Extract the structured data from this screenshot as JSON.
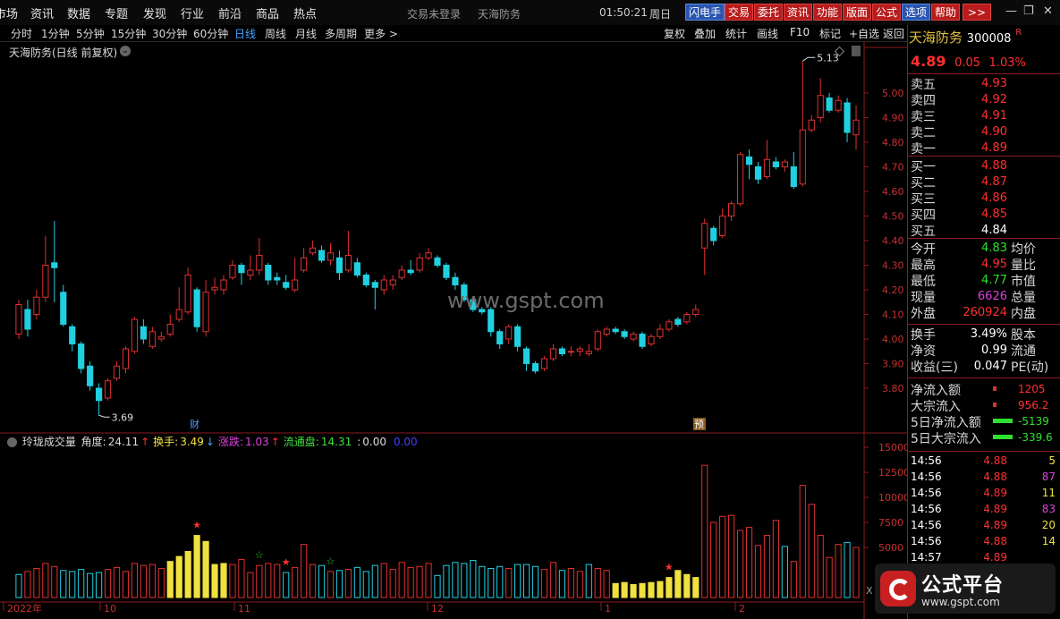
{
  "menu": {
    "items": [
      "市场",
      "资讯",
      "数据",
      "专题",
      "发现",
      "行业",
      "前沿",
      "商品",
      "热点"
    ],
    "center": [
      "交易未登录",
      "天海防务"
    ],
    "clock": "01:50:21",
    "weekday": "周日",
    "buttons": [
      "闪电手",
      "交易",
      "委托",
      "资讯",
      "功能",
      "版面",
      "公式",
      "选项",
      "帮助",
      ">>"
    ],
    "sys": [
      "—",
      "❐",
      "✕"
    ]
  },
  "periodbar": {
    "periods": [
      "分时",
      "1分钟",
      "5分钟",
      "15分钟",
      "30分钟",
      "60分钟",
      "日线",
      "周线",
      "月线",
      "多周期",
      "更多 >"
    ],
    "active": "日线",
    "tools": [
      "复权",
      "叠加",
      "统计",
      "画线",
      "F10",
      "标记",
      "+自选",
      "返回"
    ]
  },
  "chart_title": "天海防务(日线 前复权)",
  "annotations": {
    "high": "5.13",
    "low": "3.69",
    "marker_cai": "财",
    "marker_yu": "预"
  },
  "price_axis": [
    "5.00",
    "4.90",
    "4.80",
    "4.70",
    "4.60",
    "4.50",
    "4.40",
    "4.30",
    "4.20",
    "4.10",
    "4.00",
    "3.90",
    "3.80"
  ],
  "vol_axis": [
    "15000",
    "12500",
    "10000",
    "7500",
    "5000",
    "X"
  ],
  "date_axis": [
    "2022年",
    "10",
    "11",
    "12",
    "1",
    "2"
  ],
  "watermark": "www.gspt.com",
  "indicator": {
    "name": "玲珑成交量",
    "items": [
      {
        "label": "角度:",
        "value": "24.11",
        "arrow": "↑",
        "color": "#ddd"
      },
      {
        "label": "换手:",
        "value": "3.49",
        "arrow": "↓",
        "color": "#f0e040"
      },
      {
        "label": "涨跌:",
        "value": "1.03",
        "arrow": "↑",
        "color": "#e040e0"
      },
      {
        "label": "流通盘:",
        "value": "14.31",
        "arrow": "",
        "color": "#40e040"
      },
      {
        "label": ":",
        "value": "0.00",
        "arrow": "",
        "color": "#ddd"
      },
      {
        "label": "",
        "value": "0.00",
        "arrow": "",
        "color": "#4040ff"
      }
    ]
  },
  "stock": {
    "name": "天海防务",
    "code": "300008",
    "badge": "R",
    "price": "4.89",
    "change": "0.05",
    "pct": "1.03%"
  },
  "asks": [
    {
      "label": "卖五",
      "price": "4.93"
    },
    {
      "label": "卖四",
      "price": "4.92"
    },
    {
      "label": "卖三",
      "price": "4.91"
    },
    {
      "label": "卖二",
      "price": "4.90"
    },
    {
      "label": "卖一",
      "price": "4.89"
    }
  ],
  "bids": [
    {
      "label": "买一",
      "price": "4.88"
    },
    {
      "label": "买二",
      "price": "4.87"
    },
    {
      "label": "买三",
      "price": "4.86"
    },
    {
      "label": "买四",
      "price": "4.85"
    },
    {
      "label": "买五",
      "price": "4.84"
    }
  ],
  "stats": [
    {
      "l": "今开",
      "v": "4.83",
      "vc": "#30e030",
      "r": "均价"
    },
    {
      "l": "最高",
      "v": "4.95",
      "vc": "#ff3030",
      "r": "量比"
    },
    {
      "l": "最低",
      "v": "4.77",
      "vc": "#30e030",
      "r": "市值"
    },
    {
      "l": "现量",
      "v": "6626",
      "vc": "#e040e0",
      "r": "总量"
    },
    {
      "l": "外盘",
      "v": "260924",
      "vc": "#ff3030",
      "r": "内盘"
    }
  ],
  "stats2": [
    {
      "l": "换手",
      "v": "3.49%",
      "r": "股本"
    },
    {
      "l": "净资",
      "v": "0.99",
      "r": "流通"
    },
    {
      "l": "收益(三)",
      "v": "0.047",
      "r": "PE(动)"
    }
  ],
  "flows": [
    {
      "l": "净流入额",
      "v": "1205",
      "c": "#ff3030",
      "bar": "red"
    },
    {
      "l": "大宗流入",
      "v": "956.2",
      "c": "#ff3030",
      "bar": "red"
    },
    {
      "l": "5日净流入额",
      "v": "-5139",
      "c": "#30e030",
      "bar": "green"
    },
    {
      "l": "5日大宗流入",
      "v": "-339.6",
      "c": "#30e030",
      "bar": "green"
    }
  ],
  "ticks": [
    {
      "t": "14:56",
      "p": "4.88",
      "v": "5",
      "vc": "#f0e040"
    },
    {
      "t": "14:56",
      "p": "4.88",
      "v": "87",
      "vc": "#e040e0"
    },
    {
      "t": "14:56",
      "p": "4.89",
      "v": "11",
      "vc": "#f0e040"
    },
    {
      "t": "14:56",
      "p": "4.89",
      "v": "83",
      "vc": "#e040e0"
    },
    {
      "t": "14:56",
      "p": "4.89",
      "v": "20",
      "vc": "#f0e040"
    },
    {
      "t": "14:56",
      "p": "4.88",
      "v": "14",
      "vc": "#f0e040"
    },
    {
      "t": "14:57",
      "p": "4.89",
      "v": "",
      "vc": "#f0e040"
    }
  ],
  "logo": {
    "t1": "公式平台",
    "t2": "www.gspt.com"
  },
  "colors": {
    "up": "#e03030",
    "down": "#20d0e0",
    "ma": "#ffffff",
    "vol_hot": "#f0e040",
    "grid": "#8a1c1c"
  },
  "chart_data": {
    "type": "candlestick",
    "ylim": [
      3.69,
      5.13
    ],
    "candles": [
      [
        4.02,
        4.14,
        4.16,
        4.0
      ],
      [
        4.12,
        4.04,
        4.16,
        4.01
      ],
      [
        4.1,
        4.17,
        4.2,
        4.08
      ],
      [
        4.17,
        4.3,
        4.42,
        4.15
      ],
      [
        4.31,
        4.29,
        4.48,
        4.15
      ],
      [
        4.19,
        4.06,
        4.22,
        4.05
      ],
      [
        4.05,
        3.98,
        4.06,
        3.95
      ],
      [
        3.98,
        3.88,
        3.99,
        3.86
      ],
      [
        3.89,
        3.81,
        3.91,
        3.79
      ],
      [
        3.8,
        3.75,
        3.82,
        3.69
      ],
      [
        3.76,
        3.83,
        3.84,
        3.75
      ],
      [
        3.84,
        3.89,
        3.91,
        3.83
      ],
      [
        3.88,
        3.96,
        3.97,
        3.86
      ],
      [
        3.95,
        4.08,
        4.09,
        3.94
      ],
      [
        4.05,
        4.0,
        4.08,
        3.98
      ],
      [
        3.97,
        4.03,
        4.05,
        3.96
      ],
      [
        4.0,
        4.01,
        4.03,
        3.99
      ],
      [
        4.02,
        4.06,
        4.1,
        4.01
      ],
      [
        4.08,
        4.12,
        4.21,
        4.07
      ],
      [
        4.11,
        4.26,
        4.29,
        4.1
      ],
      [
        4.2,
        4.05,
        4.21,
        4.03
      ],
      [
        4.03,
        4.19,
        4.24,
        4.01
      ],
      [
        4.2,
        4.21,
        4.25,
        4.18
      ],
      [
        4.2,
        4.24,
        4.26,
        4.18
      ],
      [
        4.25,
        4.3,
        4.32,
        4.24
      ],
      [
        4.3,
        4.27,
        4.31,
        4.22
      ],
      [
        4.26,
        4.28,
        4.34,
        4.24
      ],
      [
        4.28,
        4.34,
        4.41,
        4.26
      ],
      [
        4.3,
        4.24,
        4.31,
        4.22
      ],
      [
        4.25,
        4.24,
        4.27,
        4.22
      ],
      [
        4.23,
        4.21,
        4.26,
        4.2
      ],
      [
        4.2,
        4.24,
        4.33,
        4.19
      ],
      [
        4.28,
        4.33,
        4.37,
        4.27
      ],
      [
        4.35,
        4.37,
        4.4,
        4.34
      ],
      [
        4.36,
        4.32,
        4.38,
        4.31
      ],
      [
        4.32,
        4.35,
        4.39,
        4.3
      ],
      [
        4.33,
        4.27,
        4.36,
        4.24
      ],
      [
        4.28,
        4.34,
        4.44,
        4.27
      ],
      [
        4.31,
        4.26,
        4.33,
        4.25
      ],
      [
        4.26,
        4.22,
        4.27,
        4.21
      ],
      [
        4.23,
        4.21,
        4.24,
        4.12
      ],
      [
        4.2,
        4.24,
        4.26,
        4.18
      ],
      [
        4.22,
        4.24,
        4.26,
        4.2
      ],
      [
        4.25,
        4.28,
        4.3,
        4.24
      ],
      [
        4.28,
        4.27,
        4.32,
        4.26
      ],
      [
        4.28,
        4.33,
        4.35,
        4.27
      ],
      [
        4.33,
        4.35,
        4.37,
        4.32
      ],
      [
        4.33,
        4.3,
        4.34,
        4.29
      ],
      [
        4.3,
        4.25,
        4.31,
        4.24
      ],
      [
        4.25,
        4.22,
        4.27,
        4.2
      ],
      [
        4.22,
        4.16,
        4.23,
        4.15
      ],
      [
        4.16,
        4.12,
        4.17,
        4.11
      ],
      [
        4.12,
        4.11,
        4.13,
        4.1
      ],
      [
        4.12,
        4.03,
        4.13,
        4.01
      ],
      [
        4.03,
        3.98,
        4.04,
        3.96
      ],
      [
        4.0,
        4.05,
        4.06,
        3.98
      ],
      [
        4.05,
        3.97,
        4.06,
        3.95
      ],
      [
        3.96,
        3.9,
        3.97,
        3.87
      ],
      [
        3.9,
        3.87,
        3.91,
        3.86
      ],
      [
        3.88,
        3.92,
        3.93,
        3.87
      ],
      [
        3.92,
        3.96,
        3.98,
        3.91
      ],
      [
        3.96,
        3.94,
        3.97,
        3.93
      ],
      [
        3.95,
        3.95,
        3.97,
        3.93
      ],
      [
        3.95,
        3.96,
        3.97,
        3.93
      ],
      [
        3.94,
        3.95,
        3.98,
        3.93
      ],
      [
        3.96,
        4.03,
        4.04,
        3.95
      ],
      [
        4.02,
        4.04,
        4.05,
        4.01
      ],
      [
        4.04,
        4.03,
        4.05,
        4.02
      ],
      [
        4.03,
        4.01,
        4.04,
        4.0
      ],
      [
        4.0,
        4.02,
        4.03,
        3.99
      ],
      [
        4.02,
        3.97,
        4.03,
        3.96
      ],
      [
        3.98,
        4.01,
        4.02,
        3.97
      ],
      [
        4.01,
        4.04,
        4.06,
        4.0
      ],
      [
        4.04,
        4.07,
        4.08,
        4.03
      ],
      [
        4.08,
        4.06,
        4.09,
        4.05
      ],
      [
        4.07,
        4.1,
        4.11,
        4.06
      ],
      [
        4.1,
        4.12,
        4.14,
        4.09
      ],
      [
        4.37,
        4.47,
        4.49,
        4.26
      ],
      [
        4.45,
        4.4,
        4.46,
        4.38
      ],
      [
        4.42,
        4.5,
        4.53,
        4.41
      ],
      [
        4.5,
        4.55,
        4.56,
        4.48
      ],
      [
        4.55,
        4.75,
        4.76,
        4.54
      ],
      [
        4.74,
        4.71,
        4.77,
        4.65
      ],
      [
        4.7,
        4.65,
        4.72,
        4.63
      ],
      [
        4.66,
        4.73,
        4.81,
        4.65
      ],
      [
        4.72,
        4.7,
        4.74,
        4.69
      ],
      [
        4.7,
        4.72,
        4.73,
        4.68
      ],
      [
        4.7,
        4.62,
        4.76,
        4.61
      ],
      [
        4.63,
        4.85,
        5.13,
        4.62
      ],
      [
        4.85,
        4.89,
        4.91,
        4.84
      ],
      [
        4.9,
        4.99,
        5.06,
        4.88
      ],
      [
        4.98,
        4.93,
        5.0,
        4.92
      ],
      [
        4.93,
        4.97,
        4.99,
        4.92
      ],
      [
        4.96,
        4.84,
        4.98,
        4.8
      ],
      [
        4.83,
        4.89,
        4.95,
        4.77
      ]
    ],
    "volume": [
      [
        2.3,
        "down"
      ],
      [
        2.6,
        "up"
      ],
      [
        2.9,
        "up"
      ],
      [
        3.4,
        "up"
      ],
      [
        3.1,
        "up"
      ],
      [
        2.7,
        "down"
      ],
      [
        2.6,
        "down"
      ],
      [
        2.8,
        "down"
      ],
      [
        2.4,
        "down"
      ],
      [
        2.5,
        "down"
      ],
      [
        2.8,
        "up"
      ],
      [
        3.0,
        "up"
      ],
      [
        2.6,
        "up"
      ],
      [
        3.4,
        "up"
      ],
      [
        3.2,
        "up"
      ],
      [
        3.3,
        "up"
      ],
      [
        2.9,
        "up"
      ],
      [
        3.6,
        "hot"
      ],
      [
        4.1,
        "hot"
      ],
      [
        4.6,
        "hot"
      ],
      [
        6.2,
        "hot"
      ],
      [
        5.6,
        "hot"
      ],
      [
        3.3,
        "hot"
      ],
      [
        3.4,
        "hot"
      ],
      [
        3.3,
        "up"
      ],
      [
        3.8,
        "up"
      ],
      [
        2.5,
        "up"
      ],
      [
        3.2,
        "up"
      ],
      [
        3.4,
        "up"
      ],
      [
        3.3,
        "up"
      ],
      [
        2.5,
        "down"
      ],
      [
        3.0,
        "up"
      ],
      [
        5.3,
        "up"
      ],
      [
        3.3,
        "up"
      ],
      [
        3.2,
        "down"
      ],
      [
        2.6,
        "up"
      ],
      [
        2.7,
        "down"
      ],
      [
        2.8,
        "up"
      ],
      [
        3.0,
        "down"
      ],
      [
        2.6,
        "down"
      ],
      [
        3.2,
        "down"
      ],
      [
        3.4,
        "up"
      ],
      [
        2.8,
        "up"
      ],
      [
        3.5,
        "up"
      ],
      [
        3.0,
        "up"
      ],
      [
        3.1,
        "up"
      ],
      [
        3.4,
        "up"
      ],
      [
        2.2,
        "down"
      ],
      [
        3.2,
        "down"
      ],
      [
        3.5,
        "down"
      ],
      [
        3.4,
        "down"
      ],
      [
        3.7,
        "down"
      ],
      [
        3.1,
        "down"
      ],
      [
        2.9,
        "down"
      ],
      [
        3.1,
        "down"
      ],
      [
        2.9,
        "up"
      ],
      [
        3.3,
        "down"
      ],
      [
        3.3,
        "down"
      ],
      [
        3.1,
        "down"
      ],
      [
        2.8,
        "up"
      ],
      [
        3.5,
        "up"
      ],
      [
        2.7,
        "down"
      ],
      [
        2.9,
        "up"
      ],
      [
        2.6,
        "up"
      ],
      [
        3.3,
        "down"
      ],
      [
        2.9,
        "up"
      ],
      [
        2.7,
        "up"
      ],
      [
        1.4,
        "hot"
      ],
      [
        1.5,
        "hot"
      ],
      [
        1.3,
        "hot"
      ],
      [
        1.4,
        "hot"
      ],
      [
        1.5,
        "hot"
      ],
      [
        1.6,
        "hot"
      ],
      [
        2.0,
        "hot"
      ],
      [
        2.7,
        "hot"
      ],
      [
        2.3,
        "hot"
      ],
      [
        2.0,
        "hot"
      ],
      [
        13.2,
        "up"
      ],
      [
        7.5,
        "up"
      ],
      [
        8.1,
        "up"
      ],
      [
        8.2,
        "up"
      ],
      [
        6.7,
        "up"
      ],
      [
        7.0,
        "up"
      ],
      [
        5.2,
        "up"
      ],
      [
        6.2,
        "up"
      ],
      [
        7.7,
        "up"
      ],
      [
        5.1,
        "down"
      ],
      [
        3.6,
        "up"
      ],
      [
        11.2,
        "up"
      ],
      [
        9.3,
        "up"
      ],
      [
        6.2,
        "up"
      ],
      [
        4.0,
        "up"
      ],
      [
        5.3,
        "up"
      ],
      [
        5.5,
        "down"
      ],
      [
        5.0,
        "up"
      ]
    ],
    "volume_unit": "thousand",
    "volume_ylim": [
      0,
      15000
    ],
    "stars": [
      {
        "index": 20,
        "color": "red"
      },
      {
        "index": 27,
        "color": "green"
      },
      {
        "index": 30,
        "color": "red"
      },
      {
        "index": 35,
        "color": "green"
      },
      {
        "index": 73,
        "color": "red"
      }
    ],
    "ma": [
      4.13,
      4.1,
      4.13,
      4.18,
      4.22,
      4.18,
      4.1,
      4.05,
      3.98,
      3.92,
      3.88,
      3.87,
      3.88,
      3.91,
      3.95,
      3.98,
      4.01,
      4.04,
      4.06,
      4.08,
      4.1,
      4.11,
      4.14,
      4.18,
      4.21,
      4.23,
      4.25,
      4.26,
      4.27,
      4.27,
      4.26,
      4.26,
      4.27,
      4.29,
      4.31,
      4.33,
      4.33,
      4.33,
      4.32,
      4.31,
      4.28,
      4.26,
      4.25,
      4.25,
      4.25,
      4.26,
      4.28,
      4.29,
      4.29,
      4.28,
      4.25,
      4.22,
      4.18,
      4.14,
      4.1,
      4.06,
      4.03,
      3.99,
      3.95,
      3.93,
      3.93,
      3.94,
      3.94,
      3.95,
      3.95,
      3.97,
      3.99,
      4.0,
      4.01,
      4.02,
      4.02,
      4.02,
      4.02,
      4.03,
      4.04,
      4.05,
      4.07,
      4.12,
      4.2,
      4.28,
      4.35,
      4.45,
      4.53,
      4.58,
      4.63,
      4.67,
      4.69,
      4.68,
      4.73,
      4.78,
      4.83,
      4.86,
      4.9,
      4.9,
      4.9
    ]
  }
}
